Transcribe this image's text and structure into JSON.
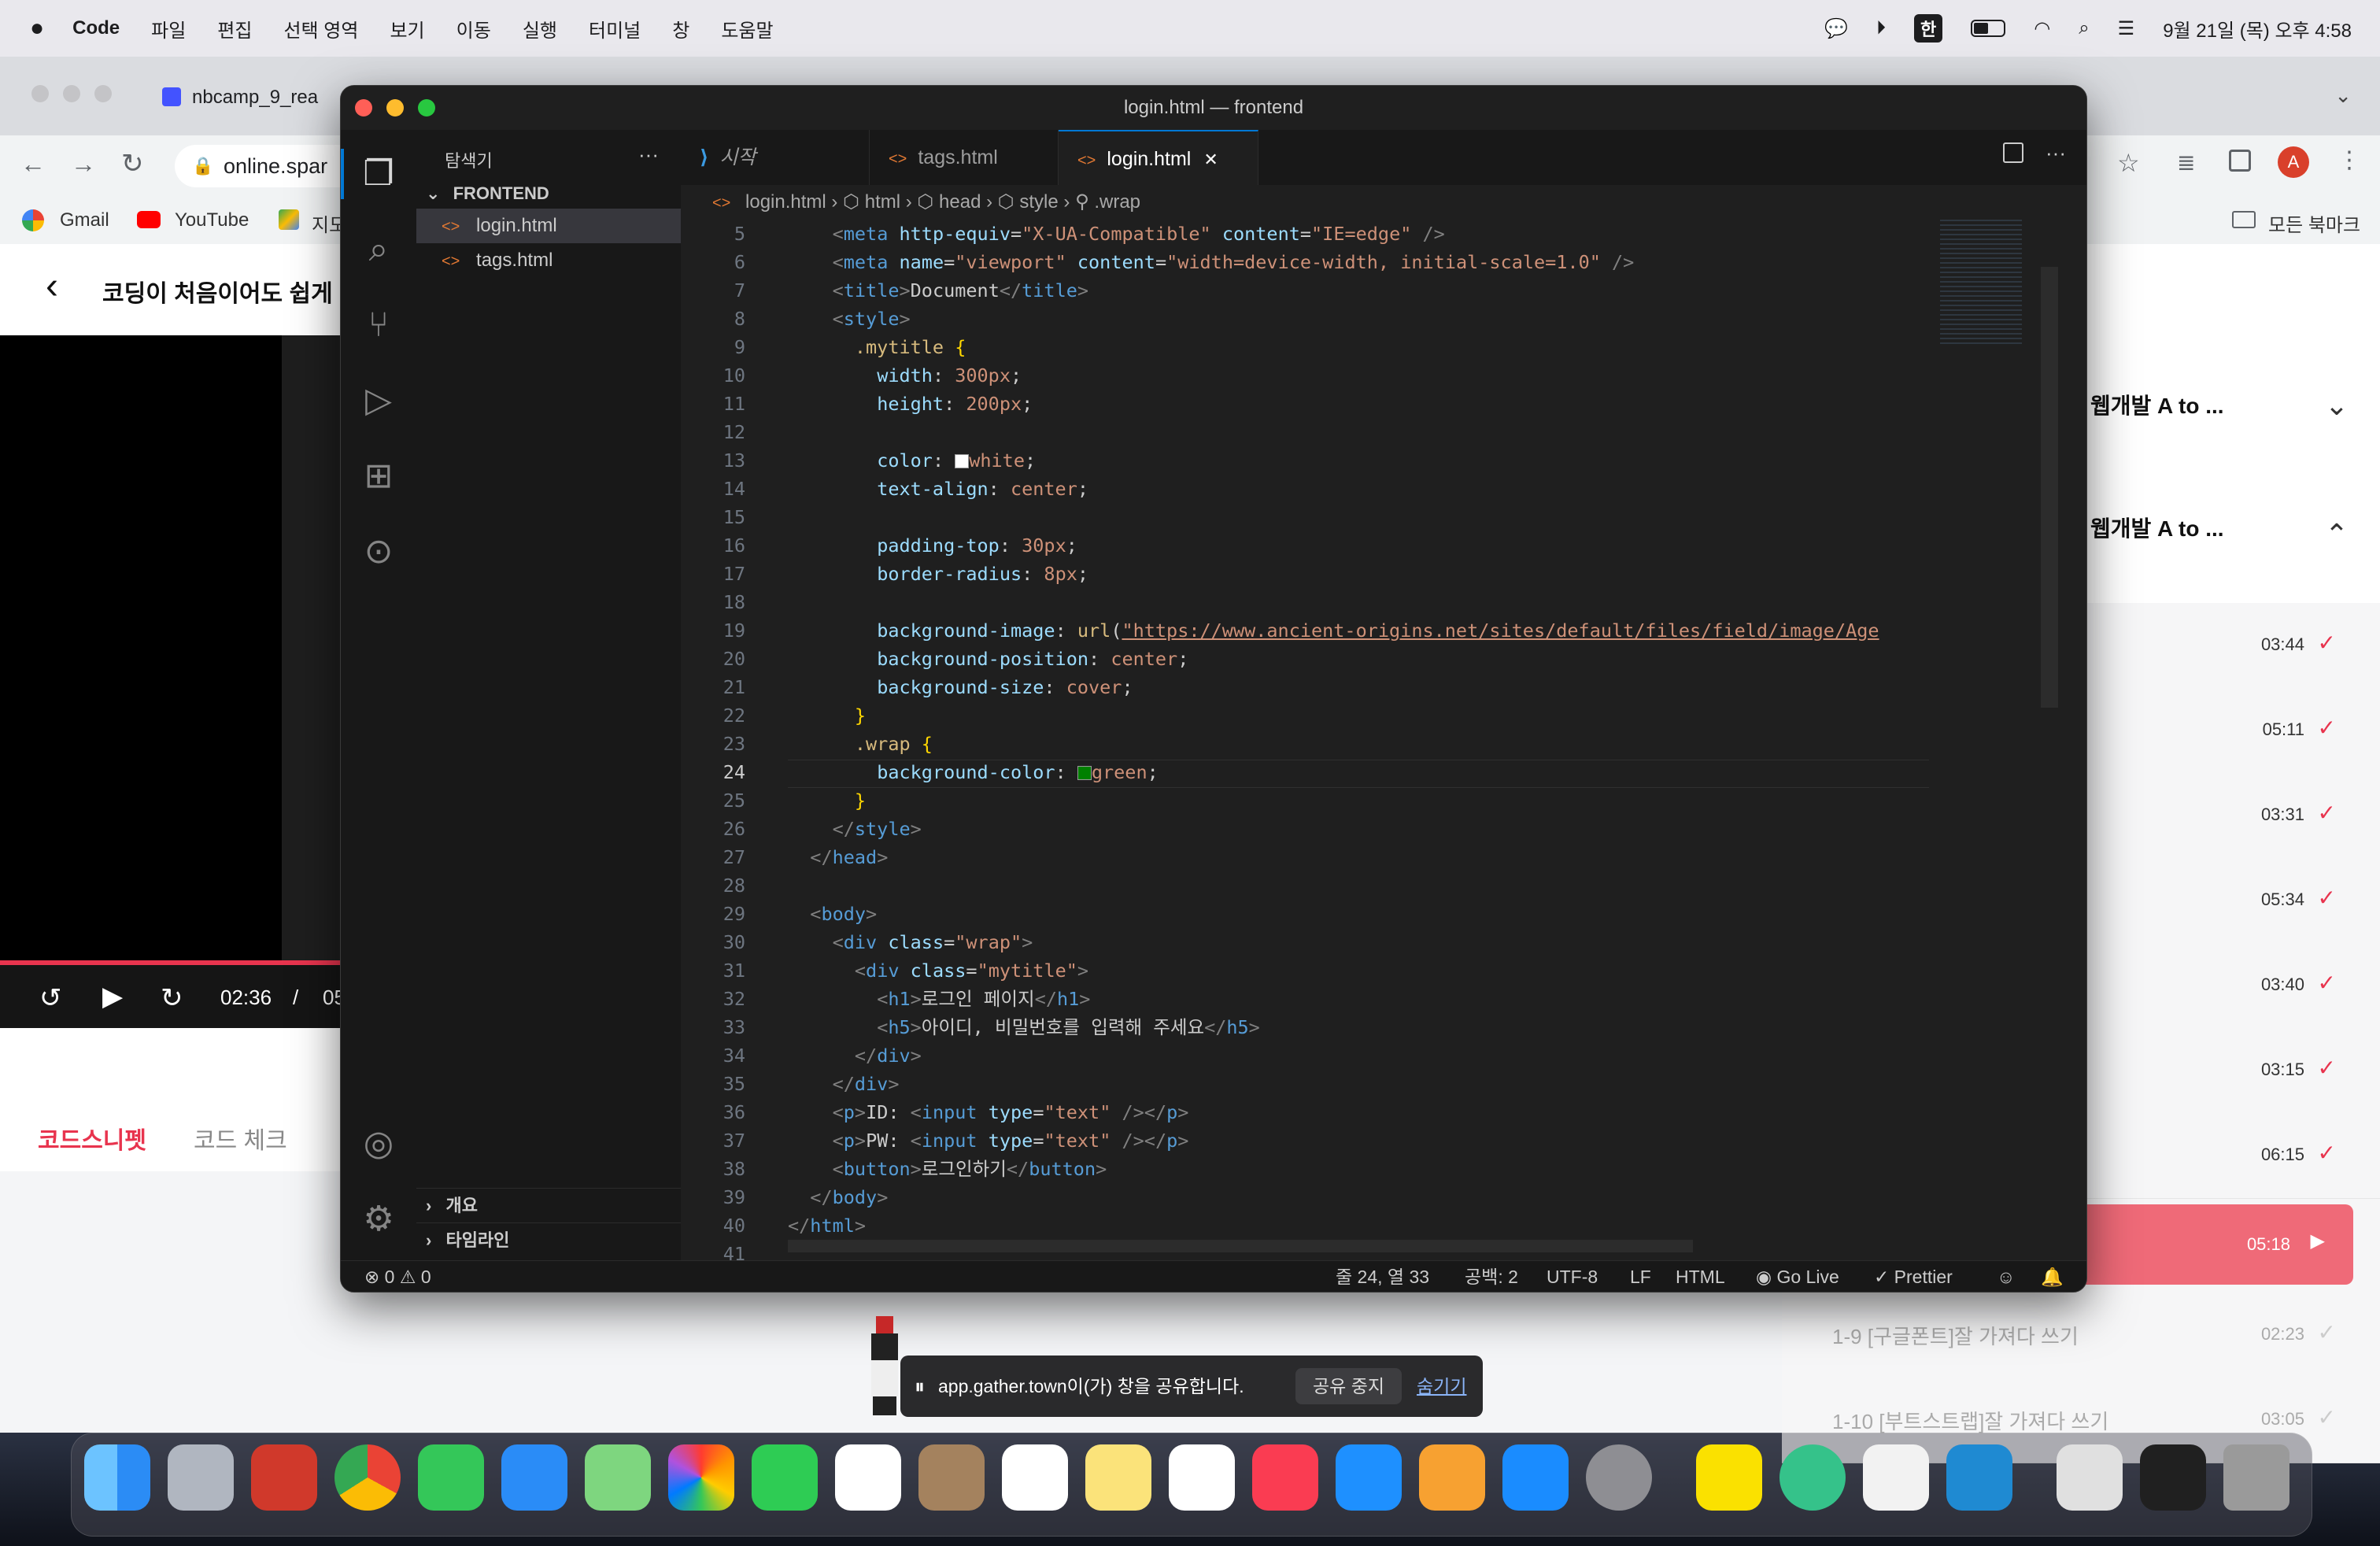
{
  "menubar": {
    "app_name": "Code",
    "items": [
      "파일",
      "편집",
      "선택 영역",
      "보기",
      "이동",
      "실행",
      "터미널",
      "창",
      "도움말"
    ],
    "input_method": "한",
    "clock": "9월 21일 (목) 오후 4:58"
  },
  "chrome": {
    "tab_title": "nbcamp_9_rea",
    "address": "online.spar",
    "bookmarks": [
      "Gmail",
      "YouTube",
      "지도"
    ],
    "all_bookmarks": "모든 북마크",
    "avatar_letter": "A"
  },
  "course_page": {
    "title": "코딩이 처음이어도 쉽게",
    "video_time": "02:36",
    "video_sep": "/",
    "video_total": "05",
    "skip_back": "10",
    "skip_fwd": "10",
    "tabs": [
      "코드스니펫",
      "코드 체크"
    ],
    "sections": [
      "웹개발 A to ...",
      "웹개발 A to ..."
    ],
    "lessons": [
      {
        "time": "03:44"
      },
      {
        "time": "05:11"
      },
      {
        "time": "03:31"
      },
      {
        "time": "05:34"
      },
      {
        "time": "03:40"
      },
      {
        "time": "03:15"
      },
      {
        "time": "06:15"
      },
      {
        "time": "05:18",
        "active": true
      },
      {
        "label": "1-9  [구글폰트]잘 가져다 쓰기",
        "time": "02:23"
      },
      {
        "label": "1-10  [부트스트랩]잘 가져다 쓰기",
        "time": "03:05"
      }
    ]
  },
  "share_banner": {
    "text": "app.gather.town이(가) 창을 공유합니다.",
    "stop": "공유 중지",
    "hide": "숨기기"
  },
  "vscode": {
    "window_title": "login.html — frontend",
    "explorer_title": "탐색기",
    "explorer_more": "···",
    "folder": "FRONTEND",
    "files": [
      "login.html",
      "tags.html"
    ],
    "outline": "개요",
    "timeline": "타임라인",
    "tabs": [
      {
        "label": "시작"
      },
      {
        "label": "tags.html"
      },
      {
        "label": "login.html",
        "active": true
      }
    ],
    "breadcrumb": [
      "login.html",
      "html",
      "head",
      "style",
      ".wrap"
    ],
    "status": {
      "errors": "0",
      "warnings": "0",
      "position": "줄 24, 열 33",
      "spaces": "공백: 2",
      "encoding": "UTF-8",
      "eol": "LF",
      "language": "HTML",
      "golive": "Go Live",
      "prettier": "Prettier"
    },
    "code": [
      {
        "n": "5",
        "h": "    <span class='p'>&lt;</span><span class='t'>meta</span> <span class='a'>http-equiv</span>=<span class='s'>\"X-UA-Compatible\"</span> <span class='a'>content</span>=<span class='s'>\"IE=edge\"</span> <span class='p'>/&gt;</span>"
      },
      {
        "n": "6",
        "h": "    <span class='p'>&lt;</span><span class='t'>meta</span> <span class='a'>name</span>=<span class='s'>\"viewport\"</span> <span class='a'>content</span>=<span class='s'>\"width=device-width, initial-scale=1.0\"</span> <span class='p'>/&gt;</span>"
      },
      {
        "n": "7",
        "h": "    <span class='p'>&lt;</span><span class='t'>title</span><span class='p'>&gt;</span>Document<span class='p'>&lt;/</span><span class='t'>title</span><span class='p'>&gt;</span>"
      },
      {
        "n": "8",
        "h": "    <span class='p'>&lt;</span><span class='t'>style</span><span class='p'>&gt;</span>"
      },
      {
        "n": "9",
        "h": "      <span class='sel'>.mytitle</span> <span class='b'>{</span>"
      },
      {
        "n": "10",
        "h": "        <span class='a'>width</span>: <span class='s'>300px</span>;"
      },
      {
        "n": "11",
        "h": "        <span class='a'>height</span>: <span class='s'>200px</span>;"
      },
      {
        "n": "12",
        "h": ""
      },
      {
        "n": "13",
        "h": "        <span class='a'>color</span>: <span style='display:inline-block;width:16px;height:16px;background:#fff;border:1px solid #999;vertical-align:-2px;'></span><span class='s'>white</span>;"
      },
      {
        "n": "14",
        "h": "        <span class='a'>text-align</span>: <span class='s'>center</span>;"
      },
      {
        "n": "15",
        "h": ""
      },
      {
        "n": "16",
        "h": "        <span class='a'>padding-top</span>: <span class='s'>30px</span>;"
      },
      {
        "n": "17",
        "h": "        <span class='a'>border-radius</span>: <span class='s'>8px</span>;"
      },
      {
        "n": "18",
        "h": ""
      },
      {
        "n": "19",
        "h": "        <span class='a'>background-image</span>: <span class='sel'>url</span>(<span class='s u'>\"https://www.ancient-origins.net/sites/default/files/field/image/Age</span>"
      },
      {
        "n": "20",
        "h": "        <span class='a'>background-position</span>: <span class='s'>center</span>;"
      },
      {
        "n": "21",
        "h": "        <span class='a'>background-size</span>: <span class='s'>cover</span>;"
      },
      {
        "n": "22",
        "h": "      <span class='b'>}</span>"
      },
      {
        "n": "23",
        "h": "      <span class='sel'>.wrap</span> <span class='b'>{</span>"
      },
      {
        "n": "24",
        "h": "        <span class='a'>background-color</span>: <span style='display:inline-block;width:16px;height:16px;background:#008000;border:1px solid #999;vertical-align:-2px;'></span><span class='s'>green</span>;"
      },
      {
        "n": "25",
        "h": "      <span class='b'>}</span>"
      },
      {
        "n": "26",
        "h": "    <span class='p'>&lt;/</span><span class='t'>style</span><span class='p'>&gt;</span>"
      },
      {
        "n": "27",
        "h": "  <span class='p'>&lt;/</span><span class='t'>head</span><span class='p'>&gt;</span>"
      },
      {
        "n": "28",
        "h": ""
      },
      {
        "n": "29",
        "h": "  <span class='p'>&lt;</span><span class='t'>body</span><span class='p'>&gt;</span>"
      },
      {
        "n": "30",
        "h": "    <span class='p'>&lt;</span><span class='t'>div</span> <span class='a'>class</span>=<span class='s'>\"wrap\"</span><span class='p'>&gt;</span>"
      },
      {
        "n": "31",
        "h": "      <span class='p'>&lt;</span><span class='t'>div</span> <span class='a'>class</span>=<span class='s'>\"mytitle\"</span><span class='p'>&gt;</span>"
      },
      {
        "n": "32",
        "h": "        <span class='p'>&lt;</span><span class='t'>h1</span><span class='p'>&gt;</span>로그인 페이지<span class='p'>&lt;/</span><span class='t'>h1</span><span class='p'>&gt;</span>"
      },
      {
        "n": "33",
        "h": "        <span class='p'>&lt;</span><span class='t'>h5</span><span class='p'>&gt;</span>아이디, 비밀번호를 입력해 주세요<span class='p'>&lt;/</span><span class='t'>h5</span><span class='p'>&gt;</span>"
      },
      {
        "n": "34",
        "h": "      <span class='p'>&lt;/</span><span class='t'>div</span><span class='p'>&gt;</span>"
      },
      {
        "n": "35",
        "h": "    <span class='p'>&lt;/</span><span class='t'>div</span><span class='p'>&gt;</span>"
      },
      {
        "n": "36",
        "h": "    <span class='p'>&lt;</span><span class='t'>p</span><span class='p'>&gt;</span>ID: <span class='p'>&lt;</span><span class='t'>input</span> <span class='a'>type</span>=<span class='s'>\"text\"</span> <span class='p'>/&gt;&lt;/</span><span class='t'>p</span><span class='p'>&gt;</span>"
      },
      {
        "n": "37",
        "h": "    <span class='p'>&lt;</span><span class='t'>p</span><span class='p'>&gt;</span>PW: <span class='p'>&lt;</span><span class='t'>input</span> <span class='a'>type</span>=<span class='s'>\"text\"</span> <span class='p'>/&gt;&lt;/</span><span class='t'>p</span><span class='p'>&gt;</span>"
      },
      {
        "n": "38",
        "h": "    <span class='p'>&lt;</span><span class='t'>button</span><span class='p'>&gt;</span>로그인하기<span class='p'>&lt;/</span><span class='t'>button</span><span class='p'>&gt;</span>"
      },
      {
        "n": "39",
        "h": "  <span class='p'>&lt;/</span><span class='t'>body</span><span class='p'>&gt;</span>"
      },
      {
        "n": "40",
        "h": "<span class='p'>&lt;/</span><span class='t'>html</span><span class='p'>&gt;</span>"
      },
      {
        "n": "41",
        "h": ""
      }
    ]
  }
}
